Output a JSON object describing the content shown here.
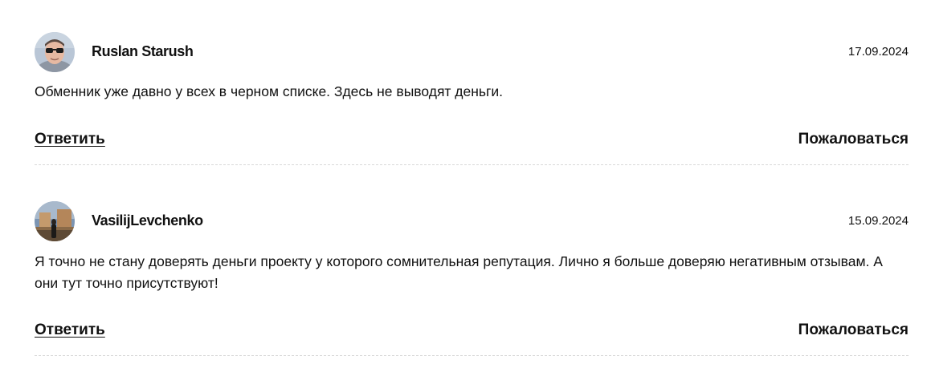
{
  "comments": [
    {
      "author": "Ruslan Starush",
      "date": "17.09.2024",
      "text": "Обменник уже давно у всех в черном списке. Здесь не выводят деньги.",
      "reply_label": "Ответить",
      "complain_label": "Пожаловаться",
      "avatar_icon": "user-photo-sunglasses"
    },
    {
      "author": "VasilijLevchenko",
      "date": "15.09.2024",
      "text": "Я точно не стану доверять деньги проекту у которого сомнительная репутация. Лично я больше доверяю негативным отзывам. А они тут точно присутствуют!",
      "reply_label": "Ответить",
      "complain_label": "Пожаловаться",
      "avatar_icon": "user-photo-outdoor"
    }
  ]
}
